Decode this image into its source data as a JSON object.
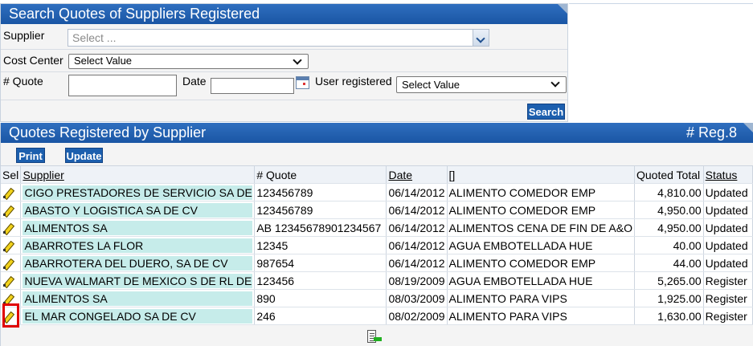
{
  "search": {
    "title": "Search Quotes of Suppliers Registered",
    "supplier_label": "Supplier",
    "supplier_placeholder": "Select ...",
    "cost_center_label": "Cost Center",
    "cost_center_value": "Select Value",
    "quote_label": "# Quote",
    "quote_value": "",
    "date_label": "Date",
    "date_value": "",
    "user_label": "User registered",
    "user_value": "Select Value",
    "search_button": "Search"
  },
  "results": {
    "title": "Quotes Registered by Supplier",
    "reg_count": "# Reg.8",
    "print_button": "Print",
    "update_button": "Update",
    "columns": {
      "sel": "Sel",
      "supplier": "Supplier",
      "quote": "# Quote",
      "date": "Date",
      "desc": "[]",
      "total": "Quoted Total",
      "status": "Status"
    },
    "rows": [
      {
        "supplier": "CIGO PRESTADORES DE SERVICIO SA DE",
        "quote": "123456789",
        "date": "06/14/2012",
        "desc": "ALIMENTO COMEDOR EMP",
        "total": "4,810.00",
        "status": "Updated"
      },
      {
        "supplier": "ABASTO Y LOGISTICA SA DE CV",
        "quote": "123456789",
        "date": "06/14/2012",
        "desc": "ALIMENTO COMEDOR EMP",
        "total": "4,950.00",
        "status": "Updated"
      },
      {
        "supplier": "ALIMENTOS SA",
        "quote": "AB 12345678901234567",
        "date": "06/14/2012",
        "desc": "ALIMENTOS CENA DE FIN DE A&O",
        "total": "4,950.00",
        "status": "Updated"
      },
      {
        "supplier": "ABARROTES LA FLOR",
        "quote": "12345",
        "date": "06/14/2012",
        "desc": "AGUA EMBOTELLADA HUE",
        "total": "40.00",
        "status": "Updated"
      },
      {
        "supplier": "ABARROTERA DEL DUERO, SA DE CV",
        "quote": "987654",
        "date": "06/14/2012",
        "desc": "ALIMENTO COMEDOR EMP",
        "total": "44.00",
        "status": "Updated"
      },
      {
        "supplier": "NUEVA WALMART DE MEXICO S DE RL DE",
        "quote": "123456",
        "date": "08/19/2009",
        "desc": "AGUA EMBOTELLADA HUE",
        "total": "5,265.00",
        "status": "Register"
      },
      {
        "supplier": "ALIMENTOS SA",
        "quote": "890",
        "date": "08/03/2009",
        "desc": "ALIMENTO PARA VIPS",
        "total": "1,925.00",
        "status": "Register"
      },
      {
        "supplier": "EL MAR CONGELADO SA DE CV",
        "quote": "246",
        "date": "08/02/2009",
        "desc": "ALIMENTO PARA VIPS",
        "total": "1,630.00",
        "status": "Register"
      }
    ]
  },
  "colors": {
    "header_blue": "#1a56a4",
    "supplier_highlight": "#c6ecea",
    "highlight_box": "#e00000"
  }
}
